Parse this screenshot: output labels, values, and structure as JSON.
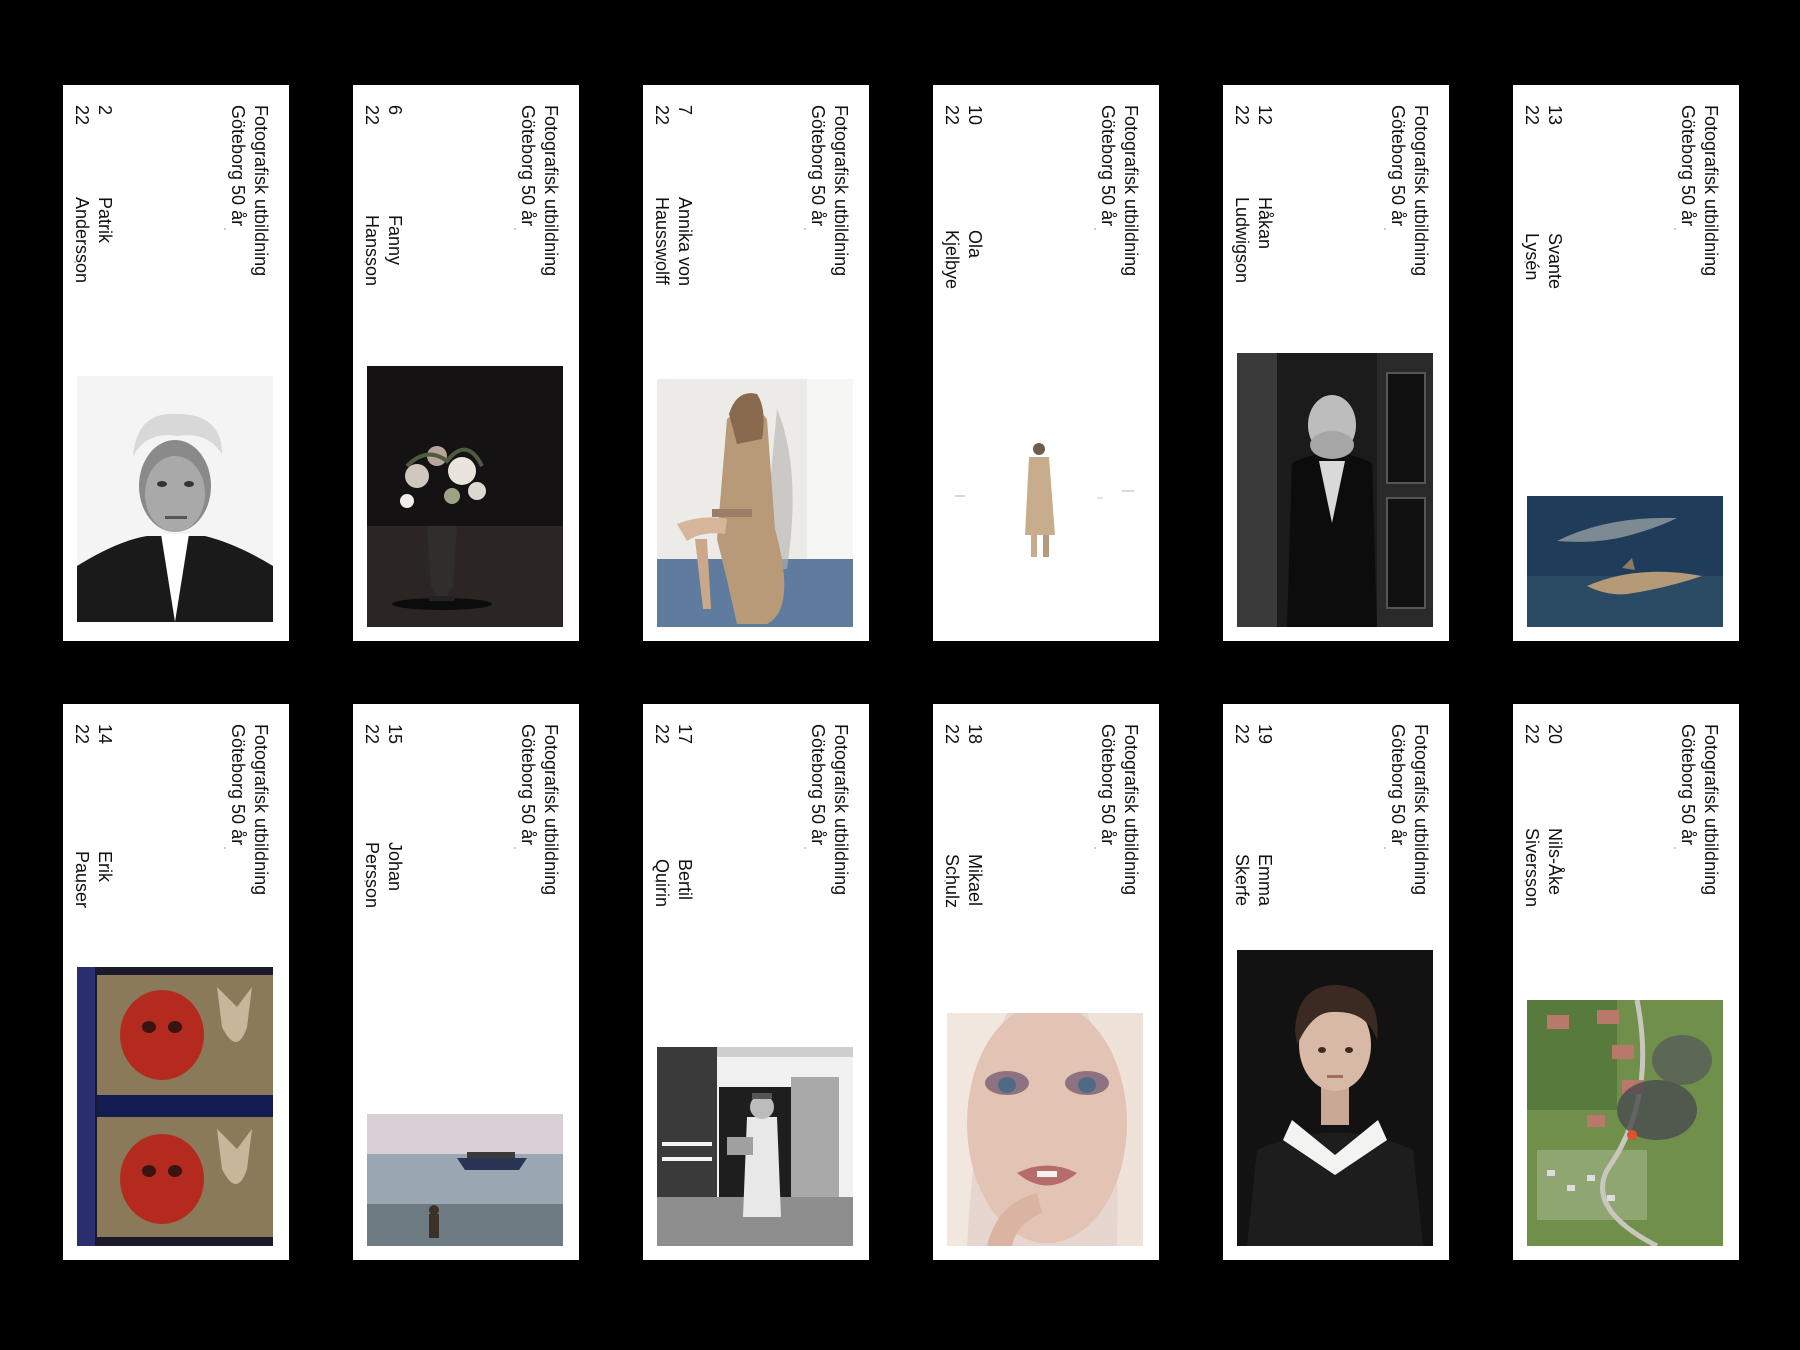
{
  "series_title": [
    "Fotografisk utbildning",
    "Göteborg 50 år"
  ],
  "cards": [
    {
      "day": "2",
      "year": "22",
      "first": "Patrik",
      "last": "Andersson",
      "photo": "portrait-man-bw-icon"
    },
    {
      "day": "6",
      "year": "22",
      "first": "Fanny",
      "last": "Hansson",
      "photo": "flower-vase-still-life-icon"
    },
    {
      "day": "7",
      "year": "22",
      "first": "Annika von",
      "last": "Hausswolff",
      "photo": "woman-in-coat-on-chair-icon"
    },
    {
      "day": "10",
      "year": "22",
      "first": "Ola",
      "last": "Kjelbye",
      "photo": "figure-in-snow-icon"
    },
    {
      "day": "12",
      "year": "22",
      "first": "Håkan",
      "last": "Ludwigson",
      "photo": "man-in-doorway-bw-icon"
    },
    {
      "day": "13",
      "year": "22",
      "first": "Svante",
      "last": "Lysén",
      "photo": "dolphins-in-water-icon"
    },
    {
      "day": "14",
      "year": "22",
      "first": "Erik",
      "last": "Pauser",
      "photo": "film-strip-mask-icon"
    },
    {
      "day": "15",
      "year": "22",
      "first": "Johan",
      "last": "Persson",
      "photo": "boat-at-sea-sunset-icon"
    },
    {
      "day": "17",
      "year": "22",
      "first": "Bertil",
      "last": "Quirin",
      "photo": "old-man-at-barn-bw-icon"
    },
    {
      "day": "18",
      "year": "22",
      "first": "Mikael",
      "last": "Schulz",
      "photo": "beauty-face-closeup-icon"
    },
    {
      "day": "19",
      "year": "22",
      "first": "Emma",
      "last": "Skerfe",
      "photo": "girl-portrait-dark-icon"
    },
    {
      "day": "20",
      "year": "22",
      "first": "Nils-Åke",
      "last": "Siversson",
      "photo": "aerial-town-smoke-icon"
    }
  ],
  "colors": {
    "background": "#000000",
    "card": "#ffffff",
    "text": "#111111"
  }
}
